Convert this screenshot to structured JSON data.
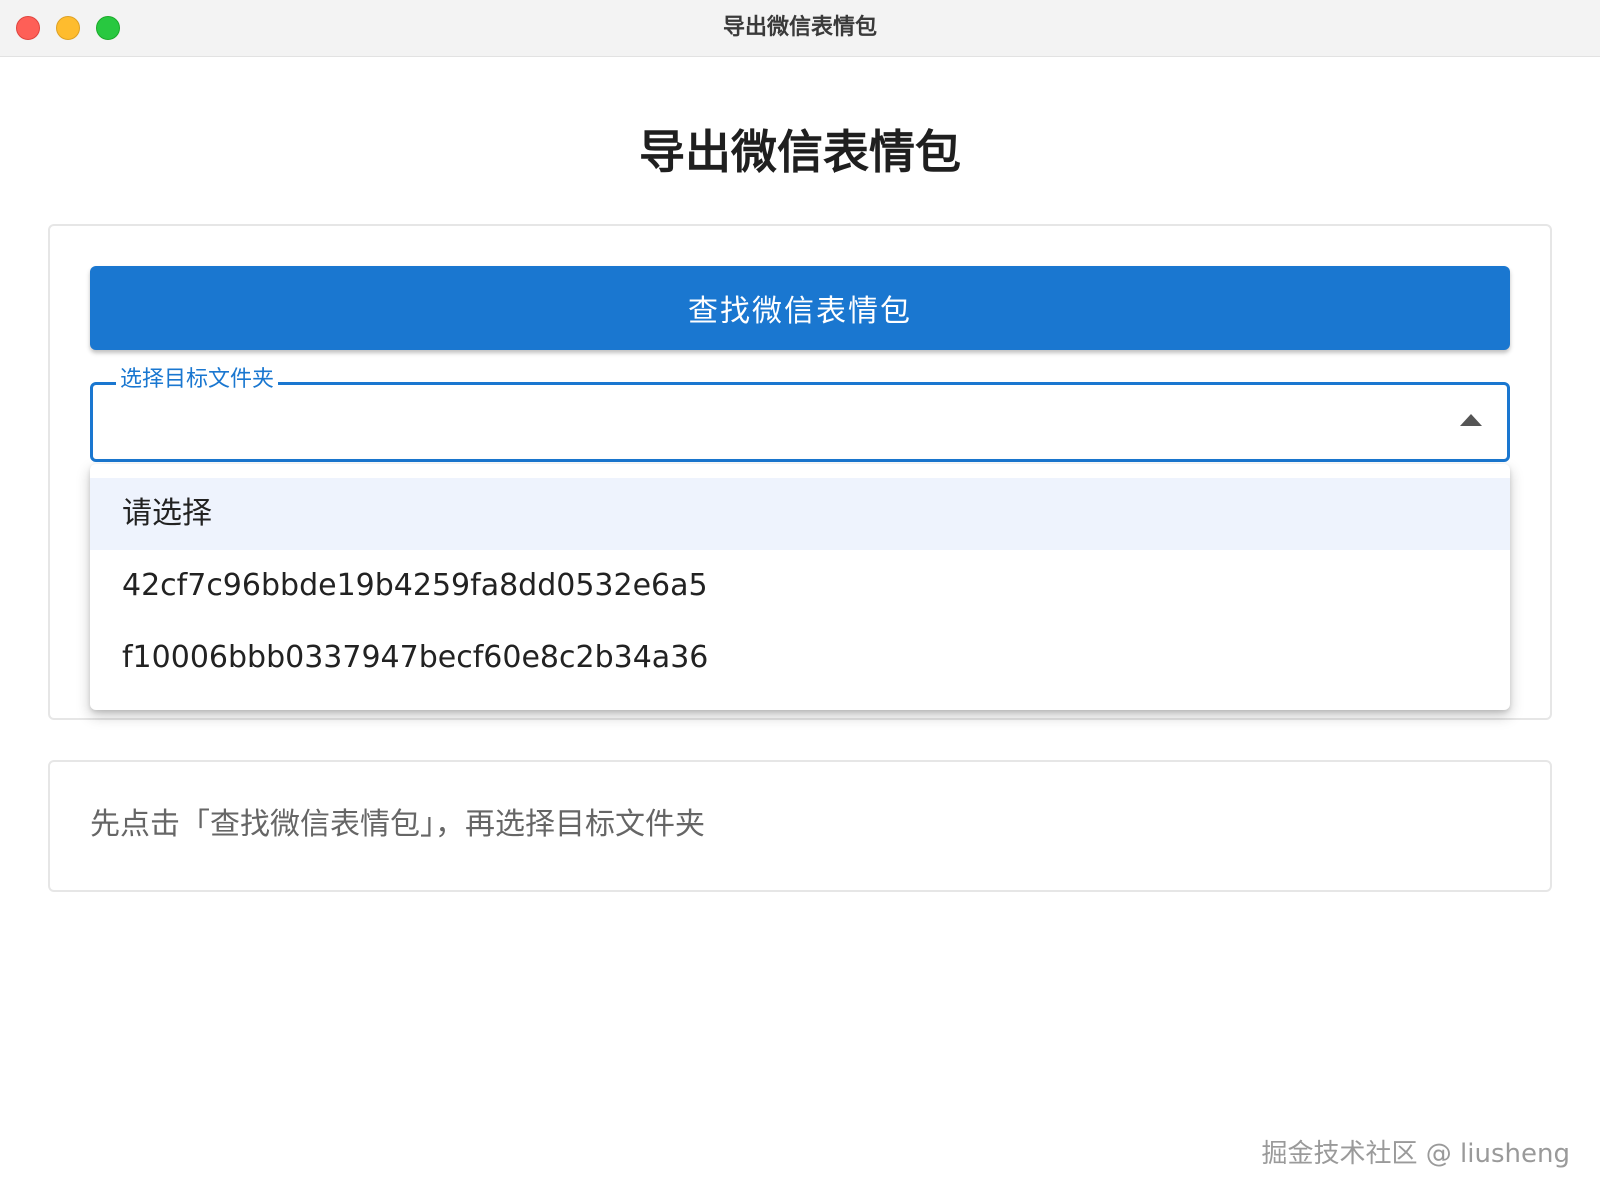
{
  "window": {
    "title": "导出微信表情包"
  },
  "page": {
    "title": "导出微信表情包"
  },
  "controls": {
    "find_button_label": "查找微信表情包",
    "select": {
      "label": "选择目标文件夹",
      "value": "",
      "options": [
        "请选择",
        "42cf7c96bbde19b4259fa8dd0532e6a5",
        "f10006bbb0337947becf60e8c2b34a36"
      ],
      "highlighted_index": 0
    }
  },
  "info": {
    "hint": "先点击「查找微信表情包」，再选择目标文件夹"
  },
  "watermark": {
    "text": "掘金技术社区 @ liusheng"
  },
  "colors": {
    "accent": "#1a77d0",
    "highlight": "#eef3fd"
  }
}
